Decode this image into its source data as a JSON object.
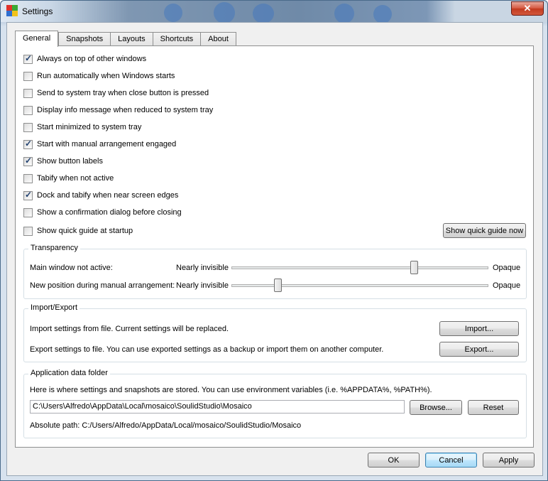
{
  "window": {
    "title": "Settings",
    "close_glyph": "✕"
  },
  "tabs": [
    {
      "label": "General",
      "active": true
    },
    {
      "label": "Snapshots",
      "active": false
    },
    {
      "label": "Layouts",
      "active": false
    },
    {
      "label": "Shortcuts",
      "active": false
    },
    {
      "label": "About",
      "active": false
    }
  ],
  "checkboxes": [
    {
      "label": "Always on top of other windows",
      "checked": true
    },
    {
      "label": "Run automatically when Windows starts",
      "checked": false
    },
    {
      "label": "Send to system tray when close button is pressed",
      "checked": false
    },
    {
      "label": "Display info message when reduced to system tray",
      "checked": false
    },
    {
      "label": "Start minimized to system tray",
      "checked": false
    },
    {
      "label": "Start with manual arrangement engaged",
      "checked": true
    },
    {
      "label": "Show button labels",
      "checked": true
    },
    {
      "label": "Tabify when not active",
      "checked": false
    },
    {
      "label": "Dock and tabify when near screen edges",
      "checked": true
    },
    {
      "label": "Show a confirmation dialog before closing",
      "checked": false
    },
    {
      "label": "Show quick guide at startup",
      "checked": false
    }
  ],
  "quick_guide_button": "Show quick guide now",
  "transparency": {
    "title": "Transparency",
    "rows": [
      {
        "label": "Main window not active:",
        "min_label": "Nearly invisible",
        "max_label": "Opaque",
        "value": 0.71
      },
      {
        "label": "New position during manual arrangement:",
        "min_label": "Nearly invisible",
        "max_label": "Opaque",
        "value": 0.18
      }
    ]
  },
  "import_export": {
    "title": "Import/Export",
    "import_text": "Import settings from file. Current settings will be replaced.",
    "import_button": "Import...",
    "export_text": "Export settings to file. You can use exported settings as a backup or import them on another computer.",
    "export_button": "Export..."
  },
  "app_data": {
    "title": "Application data folder",
    "description": "Here is where settings and snapshots are stored. You can use environment variables (i.e. %APPDATA%, %PATH%).",
    "path_value": "C:\\Users\\Alfredo\\AppData\\Local\\mosaico\\SoulidStudio\\Mosaico",
    "browse_button": "Browse...",
    "reset_button": "Reset",
    "absolute_path": "Absolute path: C:/Users/Alfredo/AppData/Local/mosaico/SoulidStudio/Mosaico"
  },
  "footer": {
    "ok": "OK",
    "cancel": "Cancel",
    "apply": "Apply"
  },
  "colors": {
    "icon_red": "#e0322a",
    "icon_green": "#3aa935",
    "icon_blue": "#2f6fd0",
    "icon_yellow": "#f2c21b"
  }
}
